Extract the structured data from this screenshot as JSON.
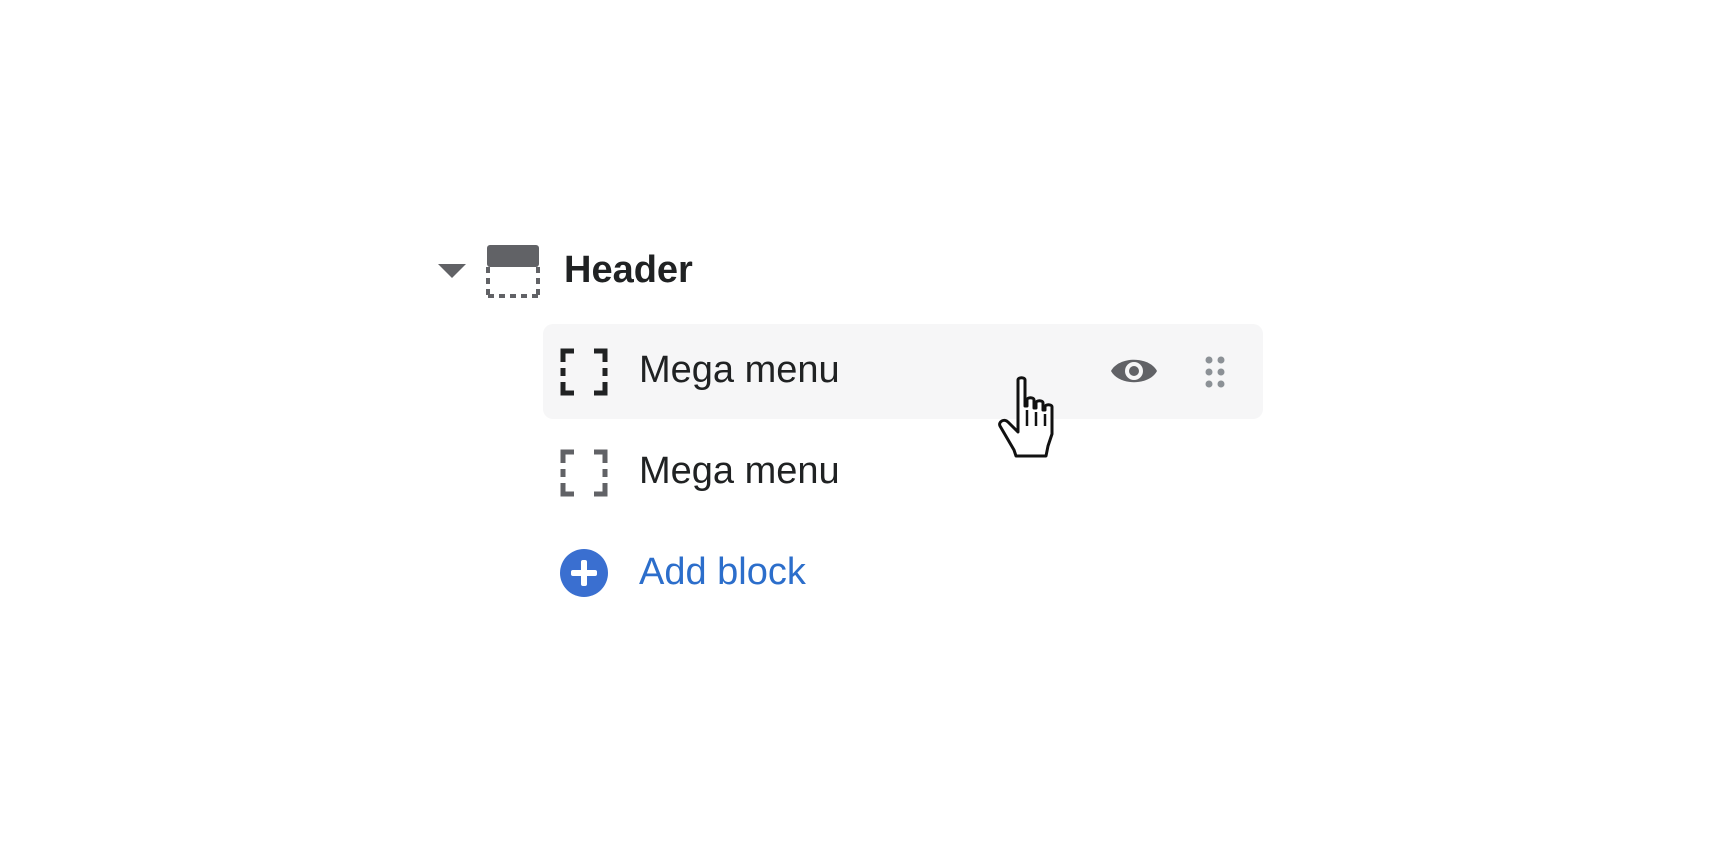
{
  "section": {
    "label": "Header",
    "caret_icon": "caret-down-icon",
    "icon": "header-section-icon"
  },
  "blocks": [
    {
      "label": "Mega menu",
      "icon": "block-dashed-frame-icon",
      "hovered": true,
      "visibility_icon": "eye-icon",
      "drag_icon": "drag-handle-icon"
    },
    {
      "label": "Mega menu",
      "icon": "block-dashed-frame-icon",
      "hovered": false
    }
  ],
  "add_block": {
    "label": "Add block",
    "icon": "plus-circle-icon"
  },
  "colors": {
    "text": "#202223",
    "icon_gray": "#616266",
    "hover_bg": "#f6f6f7",
    "accent_blue": "#2c6ecb",
    "add_icon_blue": "#3a6fd0"
  }
}
